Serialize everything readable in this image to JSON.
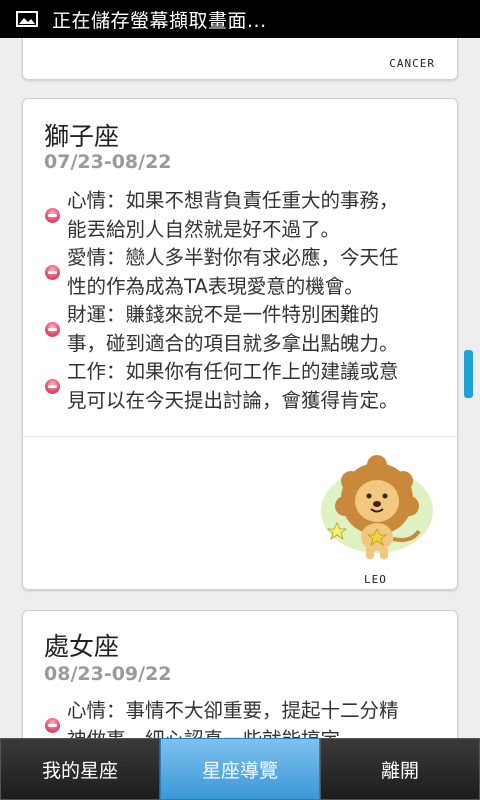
{
  "status_bar": {
    "notification_text": "正在儲存螢幕擷取畫面..."
  },
  "top_card": {
    "sign_caption": "CANCER"
  },
  "leo_card": {
    "title": "獅子座",
    "date_range": "07/23-08/22",
    "image_caption": "LEO",
    "fortunes": [
      {
        "line1": "心情：如果不想背負責任重大的事務，",
        "line2": "能丟給別人自然就是好不過了。"
      },
      {
        "line1": "愛情：戀人多半對你有求必應，今天任",
        "line2": "性的作為成為TA表現愛意的機會。"
      },
      {
        "line1": "財運：賺錢來說不是一件特別困難的",
        "line2": "事，碰到適合的項目就多拿出點魄力。"
      },
      {
        "line1": "工作：如果你有任何工作上的建議或意",
        "line2": "見可以在今天提出討論，會獲得肯定。"
      }
    ]
  },
  "virgo_card": {
    "title": "處女座",
    "date_range": "08/23-09/22",
    "fortunes": [
      {
        "line1": "心情：事情不大卻重要，提起十二分精",
        "line2": "神做事，細心認真一些就能搞定"
      }
    ]
  },
  "tabbar": {
    "tabs": [
      {
        "label": "我的星座"
      },
      {
        "label": "星座導覽"
      },
      {
        "label": "離開"
      }
    ],
    "active_tab": "星座導覽"
  },
  "colors": {
    "accent": "#3b97d6",
    "bullet": "#e8506f",
    "scroll_thumb": "#1ea3d6"
  }
}
